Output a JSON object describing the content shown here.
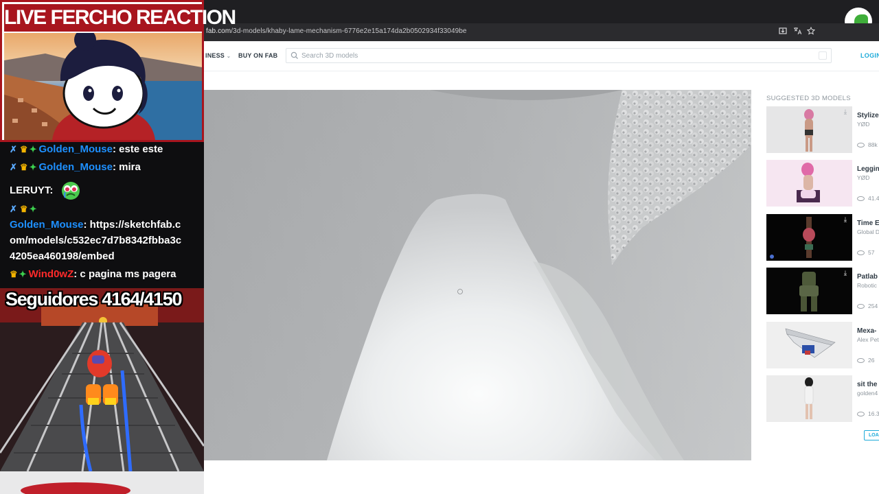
{
  "browser": {
    "url_host": "fab.com",
    "url_path": "/3d-models/khaby-lame-mechanism-6776e2e15a174da2b0502934f33049be"
  },
  "site": {
    "nav": [
      {
        "label": "INESS",
        "has_caret": true
      },
      {
        "label": "BUY ON FAB",
        "has_caret": false
      }
    ],
    "search_placeholder": "Search 3D models",
    "login_label": "LOGIN"
  },
  "suggestions": {
    "title": "SUGGESTED 3D MODELS",
    "items": [
      {
        "name": "Stylize",
        "author": "YØD",
        "views": "88k",
        "downloadable": true
      },
      {
        "name": "Leggin",
        "author": "YØD",
        "views": "41.4",
        "downloadable": false
      },
      {
        "name": "Time E",
        "author": "Global D",
        "views": "57",
        "downloadable": true
      },
      {
        "name": "Patlab",
        "author": "Robotic",
        "views": "254",
        "downloadable": true
      },
      {
        "name": "Mexa-",
        "author": "Alex Pet",
        "views": "26",
        "downloadable": false
      },
      {
        "name": "sit the",
        "author": "golden4",
        "views": "16.3",
        "downloadable": false
      }
    ],
    "load_more_label": "LOA"
  },
  "stream": {
    "banner_title": "LIVE FERCHO REACTION",
    "chat": [
      {
        "user": "Golden_Mouse",
        "user_color": "#1e90ff",
        "badges": [
          "sword",
          "crown",
          "gem"
        ],
        "message": ": este este"
      },
      {
        "user": "Golden_Mouse",
        "user_color": "#1e90ff",
        "badges": [
          "sword",
          "crown",
          "gem"
        ],
        "message": ": mira"
      },
      {
        "user": "LERUYT",
        "user_color": "#ffffff",
        "badges": [],
        "message": ":",
        "emote": "crying-face-emote"
      },
      {
        "user": "Golden_Mouse",
        "user_color": "#1e90ff",
        "badges": [
          "sword",
          "crown",
          "gem"
        ],
        "message_lines": [
          ": https://sketchfab.c",
          "om/models/c532ec7d7b8342fbba3c",
          "4205ea460198/embed"
        ]
      },
      {
        "user": "Wind0wZ",
        "user_color": "#ff2a2a",
        "badges": [
          "crown",
          "gem"
        ],
        "message": ": c pagina ms pagera"
      }
    ],
    "followers_text": "Seguidores 4164/4150"
  }
}
